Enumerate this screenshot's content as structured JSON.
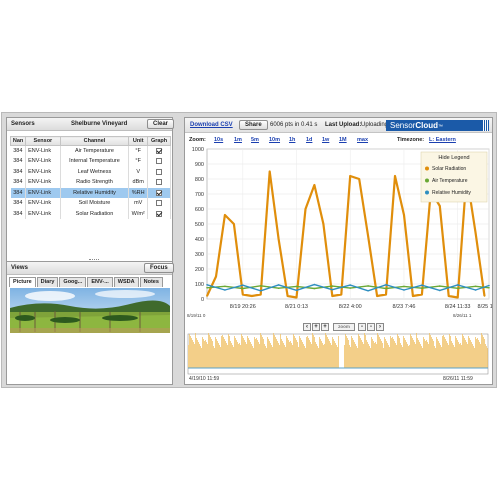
{
  "sensors": {
    "title": "Sensors",
    "site": "Shelburne Vineyard",
    "clear_label": "Clear",
    "columns": [
      "Nan",
      "Sensor",
      "Channel",
      "Unit",
      "Graph"
    ],
    "rows": [
      {
        "nan": "384",
        "sensor": "ENV-Link",
        "channel": "Air Temperature",
        "unit": "°F",
        "graph": true,
        "selected": false
      },
      {
        "nan": "384",
        "sensor": "ENV-Link",
        "channel": "Internal Temperature",
        "unit": "°F",
        "graph": false,
        "selected": false
      },
      {
        "nan": "384",
        "sensor": "ENV-Link",
        "channel": "Leaf Wetness",
        "unit": "V",
        "graph": false,
        "selected": false
      },
      {
        "nan": "384",
        "sensor": "ENV-Link",
        "channel": "Radio Strength",
        "unit": "dBm",
        "graph": false,
        "selected": false
      },
      {
        "nan": "384",
        "sensor": "ENV-Link",
        "channel": "Relative Humidity",
        "unit": "%RH",
        "graph": true,
        "selected": true
      },
      {
        "nan": "384",
        "sensor": "ENV-Link",
        "channel": "Soil Moisture",
        "unit": "mV",
        "graph": false,
        "selected": false
      },
      {
        "nan": "384",
        "sensor": "ENV-Link",
        "channel": "Solar Radiation",
        "unit": "W/m²",
        "graph": true,
        "selected": false
      }
    ]
  },
  "views": {
    "title": "Views",
    "focus_label": "Focus",
    "tabs": [
      "Picture",
      "Diary",
      "Goog...",
      "ENV-...",
      "WSDA",
      "Notes"
    ],
    "active_tab": "Picture"
  },
  "toolbar": {
    "download_label": "Download CSV",
    "share_label": "Share",
    "stats_text": "6006 pts in 0.41 s",
    "last_upload_label": "Last Upload:",
    "last_upload_value": "Uploading...",
    "logo_a": "Sensor",
    "logo_b": "Cloud",
    "logo_tm": "™"
  },
  "zoom": {
    "label": "Zoom:",
    "options": [
      "10s",
      "1m",
      "5m",
      "10m",
      "1h",
      "1d",
      "1w",
      "1M",
      "max"
    ],
    "timezone_label": "Timezone:",
    "timezone_value": "L: Eastern"
  },
  "legend": {
    "hide_label": "Hide Legend",
    "items": [
      {
        "name": "Solar Radiation",
        "color": "#e08e0b"
      },
      {
        "name": "Air Temperature",
        "color": "#6aa834"
      },
      {
        "name": "Relative Humidity",
        "color": "#2f8fc0"
      }
    ]
  },
  "navigator": {
    "start_label": "8/19/11 0",
    "start_full": "4/19/10 11:59",
    "end_label": "8/26/11 1",
    "end_full": "8/26/11 11:59",
    "scroll_label": "zoom"
  },
  "chart_data": {
    "type": "line",
    "ylim": [
      0,
      1000
    ],
    "y_ticks": [
      0,
      100,
      200,
      300,
      400,
      500,
      600,
      700,
      800,
      900,
      1000
    ],
    "x_tick_labels": [
      "8/19 20:26",
      "8/21 0:13",
      "8/22 4:00",
      "8/23 7:46",
      "8/24 11:33",
      "8/25 15:1"
    ],
    "x_domain": [
      0,
      6.3
    ],
    "x_tick_positions": [
      0.8,
      2.0,
      3.2,
      4.4,
      5.6,
      6.3
    ],
    "grid": true,
    "legend_position": "top-right",
    "series": [
      {
        "name": "Solar Radiation",
        "color": "#e08e0b",
        "x": [
          0,
          0.2,
          0.4,
          0.6,
          0.8,
          1.0,
          1.2,
          1.4,
          1.6,
          1.8,
          2.0,
          2.2,
          2.4,
          2.6,
          2.8,
          3.0,
          3.2,
          3.4,
          3.6,
          3.8,
          4.0,
          4.2,
          4.4,
          4.6,
          4.8,
          5.0,
          5.2,
          5.4,
          5.6,
          5.8,
          6.0,
          6.2
        ],
        "values": [
          20,
          150,
          560,
          500,
          30,
          20,
          30,
          850,
          400,
          20,
          10,
          600,
          760,
          500,
          20,
          30,
          820,
          800,
          420,
          20,
          30,
          820,
          560,
          20,
          30,
          720,
          620,
          20,
          10,
          830,
          440,
          20
        ]
      },
      {
        "name": "Air Temperature",
        "color": "#6aa834",
        "x": [
          0,
          0.4,
          0.8,
          1.2,
          1.6,
          2.0,
          2.4,
          2.8,
          3.2,
          3.6,
          4.0,
          4.4,
          4.8,
          5.2,
          5.6,
          6.0,
          6.3
        ],
        "values": [
          75,
          85,
          70,
          88,
          72,
          84,
          70,
          86,
          73,
          87,
          70,
          84,
          72,
          86,
          71,
          85,
          75
        ]
      },
      {
        "name": "Relative Humidity",
        "color": "#2f8fc0",
        "x": [
          0,
          0.4,
          0.8,
          1.2,
          1.6,
          2.0,
          2.4,
          2.8,
          3.2,
          3.6,
          4.0,
          4.4,
          4.8,
          5.2,
          5.6,
          6.0,
          6.3
        ],
        "values": [
          95,
          60,
          92,
          55,
          94,
          58,
          96,
          62,
          93,
          55,
          95,
          60,
          92,
          57,
          94,
          60,
          90
        ]
      }
    ]
  }
}
